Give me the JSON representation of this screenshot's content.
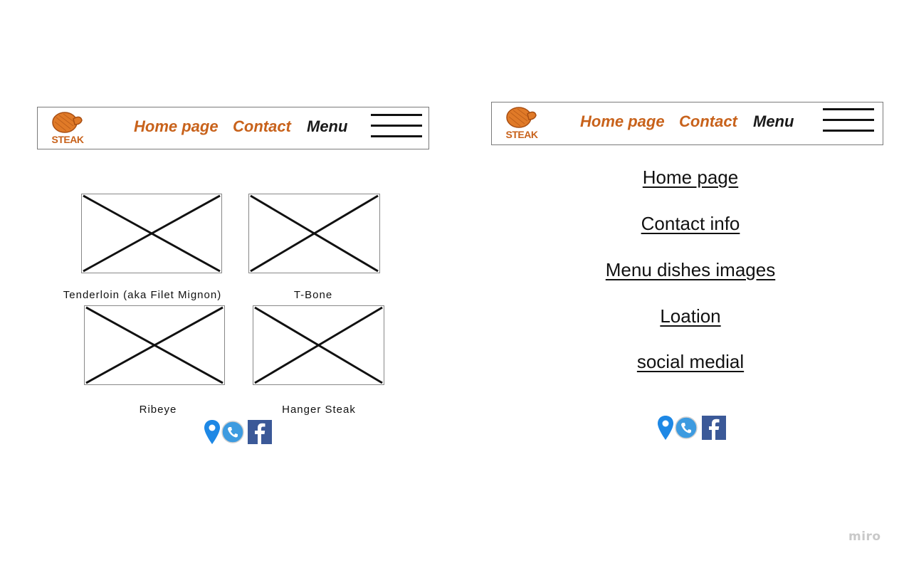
{
  "left_view": {
    "navbar": {
      "logo_text": "STEAK",
      "links": [
        "Home page",
        "Contact",
        "Menu"
      ]
    },
    "dishes": [
      {
        "caption": "Tenderloin (aka Filet Mignon)"
      },
      {
        "caption": "T-Bone"
      },
      {
        "caption": "Ribeye"
      },
      {
        "caption": "Hanger Steak"
      }
    ],
    "social_icons": [
      "location-pin-icon",
      "phone-icon",
      "facebook-icon"
    ]
  },
  "right_view": {
    "navbar": {
      "logo_text": "STEAK",
      "links": [
        "Home page",
        "Contact",
        "Menu"
      ]
    },
    "menu_items": [
      "Home page",
      "Contact info",
      "Menu dishes images",
      "Loation",
      "social medial"
    ],
    "social_icons": [
      "location-pin-icon",
      "phone-icon",
      "facebook-icon"
    ]
  },
  "watermark": "miro",
  "colors": {
    "brand_orange": "#c8621b",
    "pin_blue": "#1e88e5",
    "phone_blue": "#3d9be0",
    "facebook_blue": "#3b5998"
  }
}
